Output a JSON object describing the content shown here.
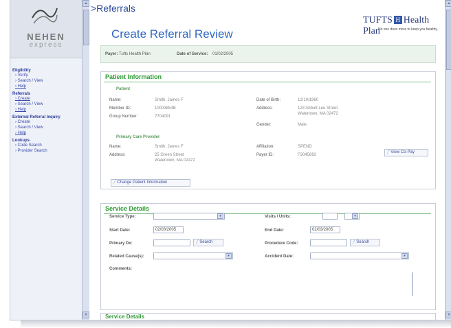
{
  "logo": {
    "line1": "NEHEN",
    "line2": "express"
  },
  "nav": [
    {
      "heading": "Eligibility",
      "links": [
        {
          "label": "Verify",
          "u": false
        },
        {
          "label": "Search / View",
          "u": false
        },
        {
          "label": "Help",
          "u": true
        }
      ]
    },
    {
      "heading": "Referrals",
      "links": [
        {
          "label": "Create",
          "u": true
        },
        {
          "label": "Search / View",
          "u": false
        },
        {
          "label": "Help",
          "u": true
        }
      ]
    },
    {
      "heading": "External Referral Inquiry",
      "links": [
        {
          "label": "Create",
          "u": false
        },
        {
          "label": "Search / View",
          "u": false
        },
        {
          "label": "Help",
          "u": true
        }
      ]
    },
    {
      "heading": "Lookups",
      "links": [
        {
          "label": "Code Search",
          "u": false
        },
        {
          "label": "Provider Search",
          "u": false
        }
      ]
    }
  ],
  "header": {
    "breadcrumb": ">Referrals",
    "title": "Create Referral Review",
    "brand": {
      "left": "TUFTS",
      "mark": "H",
      "right": "Health Plan",
      "tagline": "No one does more to keep you healthy."
    }
  },
  "payer_bar": {
    "payer_label": "Payer:",
    "payer_value": "Tufts Health Plan",
    "dos_label": "Date of Service:",
    "dos_value": "01/02/2005"
  },
  "patient": {
    "section_title": "Patient Information",
    "patient_sub": "Patient",
    "name_label": "Name:",
    "name_value": "Smith, James F",
    "member_label": "Member ID:",
    "member_value": "10003854B",
    "group_label": "Group Number:",
    "group_value": "7704091",
    "dob_label": "Date of Birth:",
    "dob_value": "12/10/1960",
    "address_label": "Address:",
    "address_line1": "123 Abbott Lee Street",
    "address_line2": "Watertown, MA 02472",
    "gender_label": "Gender:",
    "gender_value": "Male",
    "pcp_sub": "Primary Care Provider",
    "pcp_name_label": "Name:",
    "pcp_name_value": "Smith, James F",
    "pcp_address_label": "Address:",
    "pcp_address_line1": "25 Green Street",
    "pcp_address_line2": "Watertown, MA 02472",
    "affiliation_label": "Affiliation:",
    "affiliation_value": "SPEND",
    "payer_id_label": "Payer ID:",
    "payer_id_value": "F3045892",
    "view_copay": "View Co-Pay",
    "change_btn": "Change Patient Information"
  },
  "service": {
    "section_title": "Service Details",
    "service_type_label": "Service Type:",
    "visits_label": "Visits / Units:",
    "start_label": "Start Date:",
    "start_value": "02/03/2005",
    "end_label": "End Date:",
    "end_value": "02/03/2005",
    "primary_dx_label": "Primary Dx:",
    "procedure_label": "Procedure Code:",
    "search_btn": "Search",
    "related_label": "Related Cause(s):",
    "accident_label": "Accident Date:",
    "comments_label": "Comments:"
  },
  "next_section": "Service Details",
  "icons": {
    "dropdown": "▾",
    "scroll_up": "▴",
    "scroll_down": "▾"
  }
}
